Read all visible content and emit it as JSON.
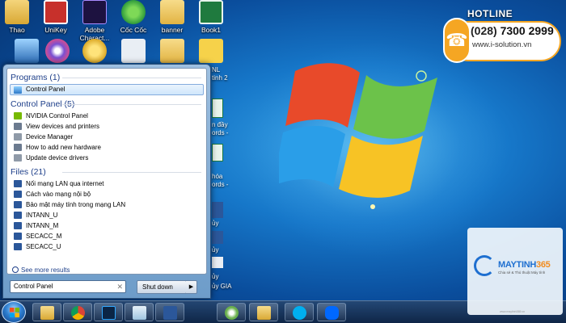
{
  "desktop": {
    "icons": [
      {
        "label": "Thao",
        "icon": "user-folder-icon"
      },
      {
        "label": "UniKey",
        "icon": "unikey-icon"
      },
      {
        "label": "Adobe Charact...",
        "icon": "adobe-character-animator-icon"
      },
      {
        "label": "Cốc Cốc",
        "icon": "coccoc-browser-icon"
      },
      {
        "label": "banner",
        "icon": "folder-icon"
      },
      {
        "label": "Book1",
        "icon": "excel-file-icon"
      }
    ],
    "partial_labels": [
      "NL",
      "tinh 2",
      "n đầy",
      "ords -",
      "hóa",
      "ords -",
      "ủy",
      "ủy",
      "ủy",
      "ủy GIA"
    ]
  },
  "hotline": {
    "title": "HOTLINE",
    "number_prefix": "(028)",
    "number_main": "7300 2999",
    "website": "www.i-solution.vn"
  },
  "start_menu": {
    "programs": {
      "header": "Programs (1)",
      "items": [
        {
          "label": "Control Panel",
          "icon": "control-panel-icon",
          "selected": true
        }
      ]
    },
    "control_panel": {
      "header": "Control Panel (5)",
      "items": [
        {
          "label": "NVIDIA Control Panel",
          "icon": "nvidia-icon"
        },
        {
          "label": "View devices and printers",
          "icon": "printer-icon"
        },
        {
          "label": "Device Manager",
          "icon": "device-manager-icon"
        },
        {
          "label": "How to add new hardware",
          "icon": "hardware-icon"
        },
        {
          "label": "Update device drivers",
          "icon": "driver-icon"
        }
      ]
    },
    "files": {
      "header": "Files (21)",
      "items": [
        {
          "label": "Nối mạng LAN qua internet",
          "icon": "word-doc-icon"
        },
        {
          "label": "Cách vào mạng nội bộ",
          "icon": "word-doc-icon"
        },
        {
          "label": "Bảo mật máy tính trong mạng LAN",
          "icon": "word-doc-icon"
        },
        {
          "label": "INTANN_U",
          "icon": "word-doc-icon"
        },
        {
          "label": "INTANN_M",
          "icon": "word-doc-icon"
        },
        {
          "label": "SECACC_M",
          "icon": "word-doc-icon"
        },
        {
          "label": "SECACC_U",
          "icon": "word-doc-icon"
        }
      ]
    },
    "see_more": "See more results",
    "search_value": "Control Panel",
    "clear_symbol": "✕",
    "shutdown_label": "Shut down",
    "shutdown_arrow": "▶"
  },
  "taskbar": {
    "buttons": [
      {
        "name": "explorer",
        "icon": "file-explorer-icon",
        "color": "#e8c04a"
      },
      {
        "name": "chrome",
        "icon": "chrome-icon",
        "color": "#db4437"
      },
      {
        "name": "photoshop",
        "icon": "photoshop-icon",
        "color": "#0b2545"
      },
      {
        "name": "notepad",
        "icon": "notepad-icon",
        "color": "#bcd7ea"
      },
      {
        "name": "word",
        "icon": "word-icon",
        "color": "#2b579a"
      },
      {
        "name": "camtasia",
        "icon": "camtasia-icon",
        "color": "#6ab04c"
      },
      {
        "name": "folder",
        "icon": "folder-icon",
        "color": "#e8c04a"
      },
      {
        "name": "skype",
        "icon": "skype-icon",
        "color": "#00aff0"
      },
      {
        "name": "zalo",
        "icon": "zalo-icon",
        "color": "#0068ff"
      }
    ]
  },
  "brand": {
    "name_part1": "MAYTINH",
    "name_part2": "365",
    "slogan": "Chia sẻ & Thủ thuật Máy tính",
    "footer": "www.maytinh365.vn"
  },
  "colors": {
    "accent": "#1e3f8a",
    "hotline_orange": "#f5a623",
    "brand_blue": "#1e6fd0",
    "brand_orange": "#f28c1e"
  }
}
